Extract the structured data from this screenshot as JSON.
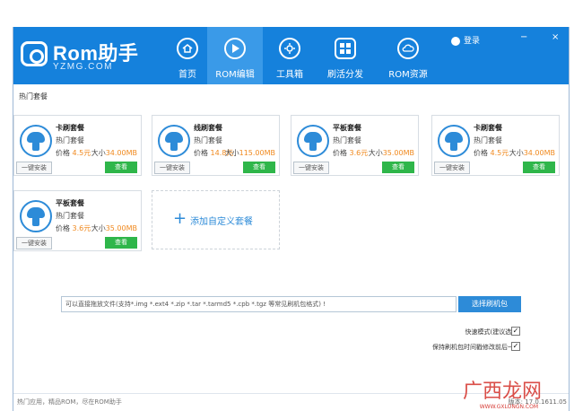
{
  "app": {
    "logo_text": "Rom助手",
    "logo_sub": "YZMG.COM"
  },
  "nav": [
    {
      "id": "home",
      "label": "首页",
      "icon": "home-icon",
      "active": false
    },
    {
      "id": "rom-edit",
      "label": "ROM编辑",
      "icon": "play-icon",
      "active": true
    },
    {
      "id": "toolbox",
      "label": "工具箱",
      "icon": "gear-icon",
      "active": false
    },
    {
      "id": "distribution",
      "label": "刷活分发",
      "icon": "grid-icon",
      "active": false
    },
    {
      "id": "rom-resources",
      "label": "ROM资源",
      "icon": "cloud-icon",
      "active": false
    }
  ],
  "header_right": {
    "login": "登录",
    "min": "−",
    "close": "×"
  },
  "section_title": "热门套餐",
  "cards": [
    {
      "title": "卡刷套餐",
      "sub": "热门套餐",
      "price_label": "价格",
      "price": "4.5元",
      "size_label": "大小",
      "size": "34.00MB",
      "install": "一键安装",
      "view": "查看"
    },
    {
      "title": "线刷套餐",
      "sub": "热门套餐",
      "price_label": "价格",
      "price": "14.8元",
      "size_label": "大小",
      "size": "115.00MB",
      "install": "一键安装",
      "view": "查看"
    },
    {
      "title": "平板套餐",
      "sub": "热门套餐",
      "price_label": "价格",
      "price": "3.6元",
      "size_label": "大小",
      "size": "35.00MB",
      "install": "一键安装",
      "view": "查看"
    },
    {
      "title": "卡刷套餐",
      "sub": "热门套餐",
      "price_label": "价格",
      "price": "4.5元",
      "size_label": "大小",
      "size": "34.00MB",
      "install": "一键安装",
      "view": "查看"
    },
    {
      "title": "平板套餐",
      "sub": "热门套餐",
      "price_label": "价格",
      "price": "3.6元",
      "size_label": "大小",
      "size": "35.00MB",
      "install": "一键安装",
      "view": "查看"
    }
  ],
  "add_card": {
    "label": "添加自定义套餐"
  },
  "file": {
    "placeholder": "可以直接拖放文件(支持*.img *.ext4 *.zip *.tar *.tarmd5 *.cpb *.tgz 等常见刷机包格式) !",
    "button": "选择刷机包"
  },
  "options": [
    {
      "label": "快速模式(建议选择)",
      "checked": true
    },
    {
      "label": "保持刷机包时间戳修改前后一致",
      "checked": true
    }
  ],
  "footer": {
    "left": "热门应用，精品ROM，尽在ROM助手",
    "right": "版本: 17.0.1611.05"
  },
  "watermark": {
    "text": "广西龙网",
    "sub": "WWW.GXLONGN.COM"
  },
  "colors": {
    "header": "#1581dc",
    "accent": "#2d8bd8",
    "green": "#2fb64a",
    "price": "#f08a20"
  }
}
